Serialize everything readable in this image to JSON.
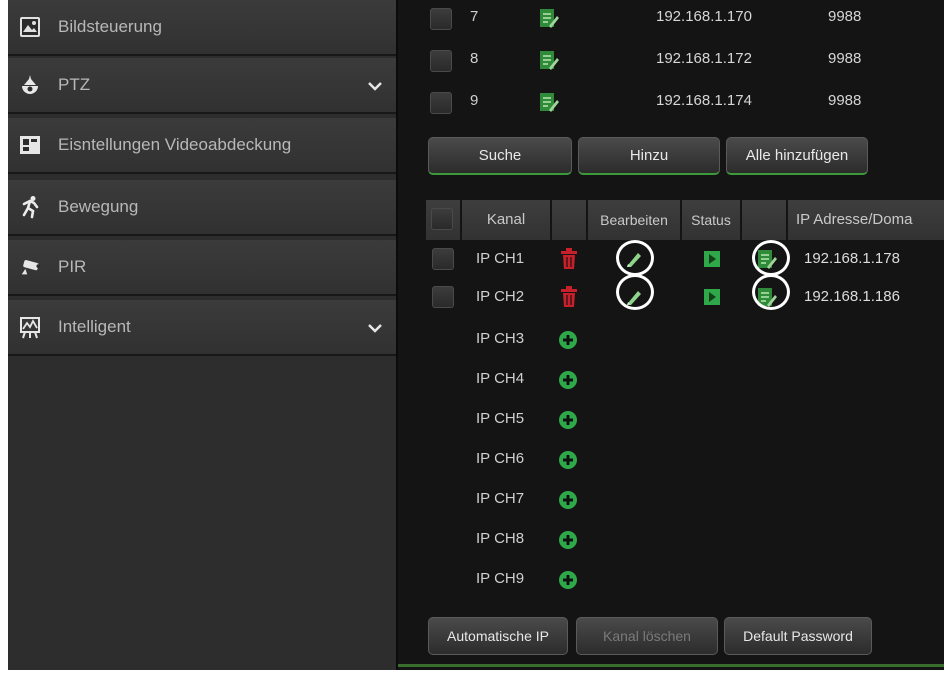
{
  "sidebar": {
    "items": [
      {
        "label": "Bildsteuerung",
        "icon": "image-control-icon",
        "expandable": false
      },
      {
        "label": "PTZ",
        "icon": "ptz-camera-icon",
        "expandable": true
      },
      {
        "label": "Eisntellungen Videoabdeckung",
        "icon": "video-mask-icon",
        "expandable": false
      },
      {
        "label": "Bewegung",
        "icon": "motion-icon",
        "expandable": false
      },
      {
        "label": "PIR",
        "icon": "pir-icon",
        "expandable": false
      },
      {
        "label": "Intelligent",
        "icon": "intelligent-icon",
        "expandable": true
      }
    ]
  },
  "device_list": {
    "rows": [
      {
        "num": "7",
        "ip": "192.168.1.170",
        "port": "9988"
      },
      {
        "num": "8",
        "ip": "192.168.1.172",
        "port": "9988"
      },
      {
        "num": "9",
        "ip": "192.168.1.174",
        "port": "9988"
      }
    ]
  },
  "search_buttons": {
    "search": "Suche",
    "add": "Hinzu",
    "add_all": "Alle hinzufügen"
  },
  "channel_table": {
    "headers": {
      "channel": "Kanal",
      "edit": "Bearbeiten",
      "status": "Status",
      "ip": "IP Adresse/Doma"
    },
    "added": [
      {
        "label": "IP CH1",
        "ip": "192.168.1.178"
      },
      {
        "label": "IP CH2",
        "ip": "192.168.1.186"
      }
    ],
    "empty": [
      "IP CH3",
      "IP CH4",
      "IP CH5",
      "IP CH6",
      "IP CH7",
      "IP CH8",
      "IP CH9"
    ]
  },
  "bottom_buttons": {
    "auto_ip": "Automatische IP",
    "delete_channel": "Kanal löschen",
    "default_password": "Default Password"
  },
  "colors": {
    "accent_green": "#3d9a3a",
    "delete_red": "#c8202a",
    "add_green": "#2fa84a"
  }
}
